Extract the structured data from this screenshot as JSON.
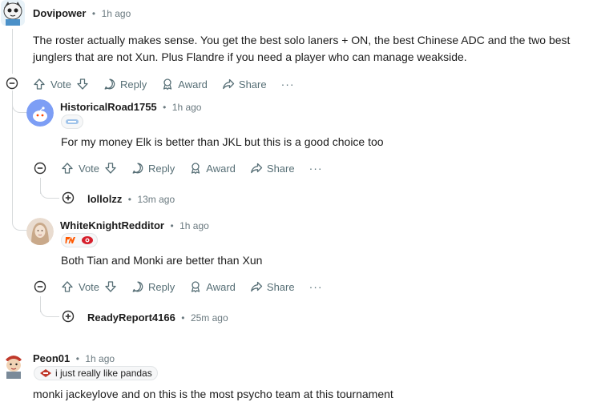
{
  "comments": [
    {
      "username": "Dovipower",
      "time": "1h ago",
      "body_line1": "The roster actually makes sense. You get the best solo laners + ON, the best Chinese ADC and the two best",
      "body_line2": "junglers that are not Xun. Plus Flandre if you need a player who can manage weakside."
    },
    {
      "username": "HistoricalRoad1755",
      "time": "1h ago",
      "body": "For my money Elk is better than JKL but this is a good choice too"
    },
    {
      "username": "lollolzz",
      "time": "13m ago"
    },
    {
      "username": "WhiteKnightRedditor",
      "time": "1h ago",
      "body": "Both Tian and Monki are better than Xun"
    },
    {
      "username": "ReadyReport4166",
      "time": "25m ago"
    },
    {
      "username": "Peon01",
      "time": "1h ago",
      "flair": "i just really like pandas",
      "body": "monki jackeylove and on this is the most psycho team at this tournament"
    }
  ],
  "actions": {
    "vote": "Vote",
    "reply": "Reply",
    "award": "Award",
    "share": "Share",
    "more": "···",
    "separator": "•"
  },
  "colors": {
    "text": "#1c1c1c",
    "meta": "#6b7a80",
    "action": "#576f76",
    "thread_line": "#d7dadc",
    "fnatic_orange": "#ff5900"
  }
}
